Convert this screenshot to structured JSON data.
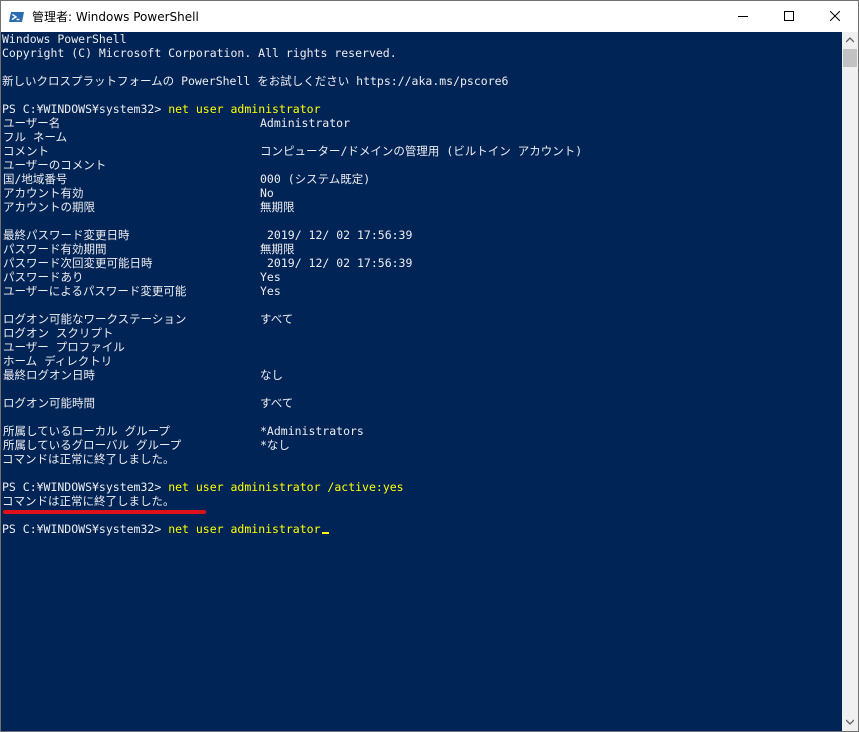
{
  "window": {
    "title": "管理者: Windows PowerShell"
  },
  "colors": {
    "console_background": "#012456",
    "console_text": "#eeedf0",
    "command_text": "#ffff00",
    "highlight_underline": "#e0101a"
  },
  "icons": {
    "app": "powershell-icon",
    "minimize": "minimize-icon",
    "maximize": "maximize-icon",
    "close": "close-icon",
    "scroll_up": "arrow-up-icon",
    "scroll_down": "arrow-down-icon"
  },
  "console": {
    "banner": {
      "line1": "Windows PowerShell",
      "line2": "Copyright (C) Microsoft Corporation. All rights reserved.",
      "line3": "新しいクロスプラットフォームの PowerShell をお試しください https://aka.ms/pscore6"
    },
    "prompt": "PS C:¥WINDOWS¥system32>",
    "command1": "net user administrator",
    "user_info": [
      {
        "label": "ユーザー名",
        "value": "Administrator"
      },
      {
        "label": "フル ネーム",
        "value": ""
      },
      {
        "label": "コメント",
        "value": "コンピューター/ドメインの管理用 (ビルトイン アカウント)"
      },
      {
        "label": "ユーザーのコメント",
        "value": ""
      },
      {
        "label": "国/地域番号",
        "value": "000 (システム既定)"
      },
      {
        "label": "アカウント有効",
        "value": "No"
      },
      {
        "label": "アカウントの期限",
        "value": "無期限"
      },
      {
        "label": "最終パスワード変更日時",
        "value": "2019/ 12/ 02 17:56:39"
      },
      {
        "label": "パスワード有効期間",
        "value": "無期限"
      },
      {
        "label": "パスワード次回変更可能日時",
        "value": "2019/ 12/ 02 17:56:39"
      },
      {
        "label": "パスワードあり",
        "value": "Yes"
      },
      {
        "label": "ユーザーによるパスワード変更可能",
        "value": "Yes"
      },
      {
        "label": "ログオン可能なワークステーション",
        "value": "すべて"
      },
      {
        "label": "ログオン スクリプト",
        "value": ""
      },
      {
        "label": "ユーザー プロファイル",
        "value": ""
      },
      {
        "label": "ホーム ディレクトリ",
        "value": ""
      },
      {
        "label": "最終ログオン日時",
        "value": "なし"
      },
      {
        "label": "ログオン可能時間",
        "value": "すべて"
      },
      {
        "label": "所属しているローカル グループ",
        "value": "*Administrators"
      },
      {
        "label": "所属しているグローバル グループ",
        "value": "*なし"
      }
    ],
    "completed1": "コマンドは正常に終了しました。",
    "command2": "net user administrator /active:yes",
    "completed2": "コマンドは正常に終了しました。",
    "command3": "net user administrator"
  }
}
